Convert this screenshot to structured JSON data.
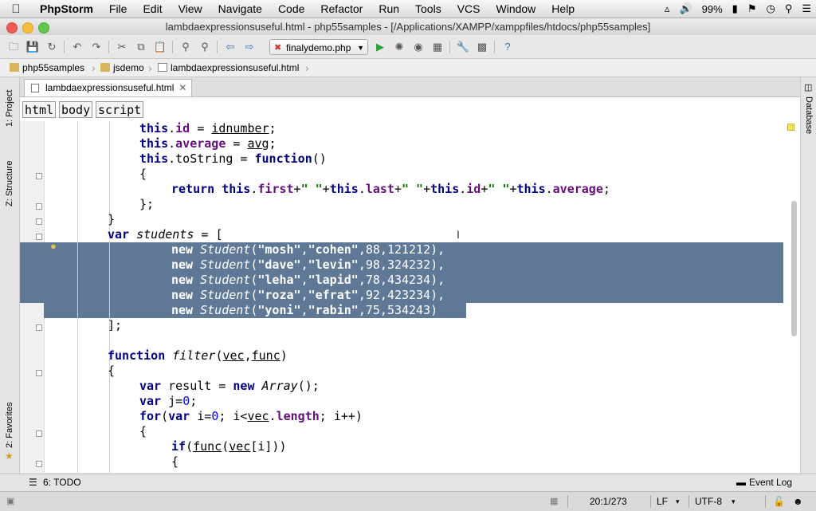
{
  "menubar": {
    "app": "PhpStorm",
    "items": [
      "File",
      "Edit",
      "View",
      "Navigate",
      "Code",
      "Refactor",
      "Run",
      "Tools",
      "VCS",
      "Window",
      "Help"
    ],
    "battery": "99%"
  },
  "window": {
    "title": "lambdaexpressionsuseful.html - php55samples - [/Applications/XAMPP/xamppfiles/htdocs/php55samples]"
  },
  "toolbar": {
    "run_config": "finalydemo.php"
  },
  "breadcrumbs": [
    "php55samples",
    "jsdemo",
    "lambdaexpressionsuseful.html"
  ],
  "side_tools": {
    "project": "1: Project",
    "structure": "Z: Structure",
    "favorites": "2: Favorites",
    "database": "Database"
  },
  "editor": {
    "tab_label": "lambdaexpressionsuseful.html",
    "tag_path": [
      "html",
      "body",
      "script"
    ]
  },
  "code": [
    "this.id = idnumber;",
    "this.average = avg;",
    "this.toString = function()",
    "{",
    "return this.first+\" \"+this.last+\" \"+this.id+\" \"+this.average;",
    "};",
    "}",
    "var students = [",
    "new Student(\"mosh\",\"cohen\",88,121212),",
    "new Student(\"dave\",\"levin\",98,324232),",
    "new Student(\"leha\",\"lapid\",78,434234),",
    "new Student(\"roza\",\"efrat\",92,423234),",
    "new Student(\"yoni\",\"rabin\",75,534243)",
    "];",
    "function filter(vec,func)",
    "{",
    "var result = new Array();",
    "var j=0;",
    "for(var i=0; i<vec.length; i++)",
    "{",
    "if(func(vec[i]))",
    "{"
  ],
  "bottom": {
    "todo": "6: TODO",
    "event_log": "Event Log"
  },
  "status": {
    "position": "20:1/273",
    "line_separator": "LF",
    "encoding": "UTF-8"
  },
  "colors": {
    "selection": "#5e7896",
    "keyword": "#000080",
    "string": "#008000",
    "number": "#0000ff",
    "field": "#660e7a"
  }
}
